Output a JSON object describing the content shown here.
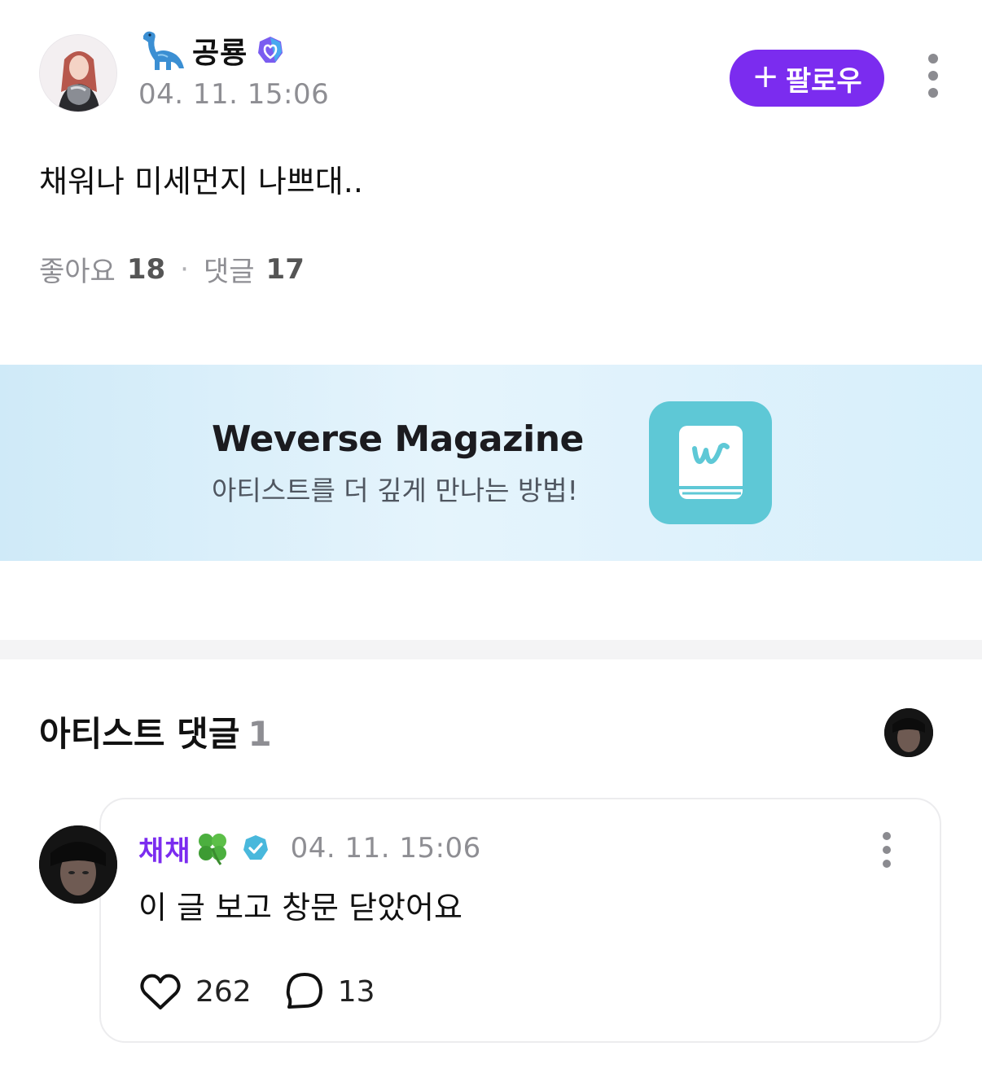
{
  "post": {
    "author_name": "공룡",
    "author_emoji": "dinosaur-icon",
    "timestamp": "04. 11. 15:06",
    "follow_label": "팔로우",
    "body": "채워나 미세먼지 나쁘대..",
    "likes_label": "좋아요",
    "likes_count": "18",
    "comments_label": "댓글",
    "comments_count": "17"
  },
  "banner": {
    "title": "Weverse Magazine",
    "subtitle": "아티스트를 더 깊게 만나는 방법!",
    "icon": "weverse-magazine-book-icon"
  },
  "artist_comments": {
    "title": "아티스트 댓글",
    "count": "1",
    "comment": {
      "author_name": "채채",
      "author_emoji": "clover-icon",
      "timestamp": "04. 11. 15:06",
      "text": "이 글 보고 창문 닫았어요",
      "likes": "262",
      "replies": "13"
    }
  },
  "colors": {
    "accent_purple": "#7b2cef",
    "banner_icon_teal": "#5ec8d6",
    "muted_text": "#8e8e93"
  }
}
